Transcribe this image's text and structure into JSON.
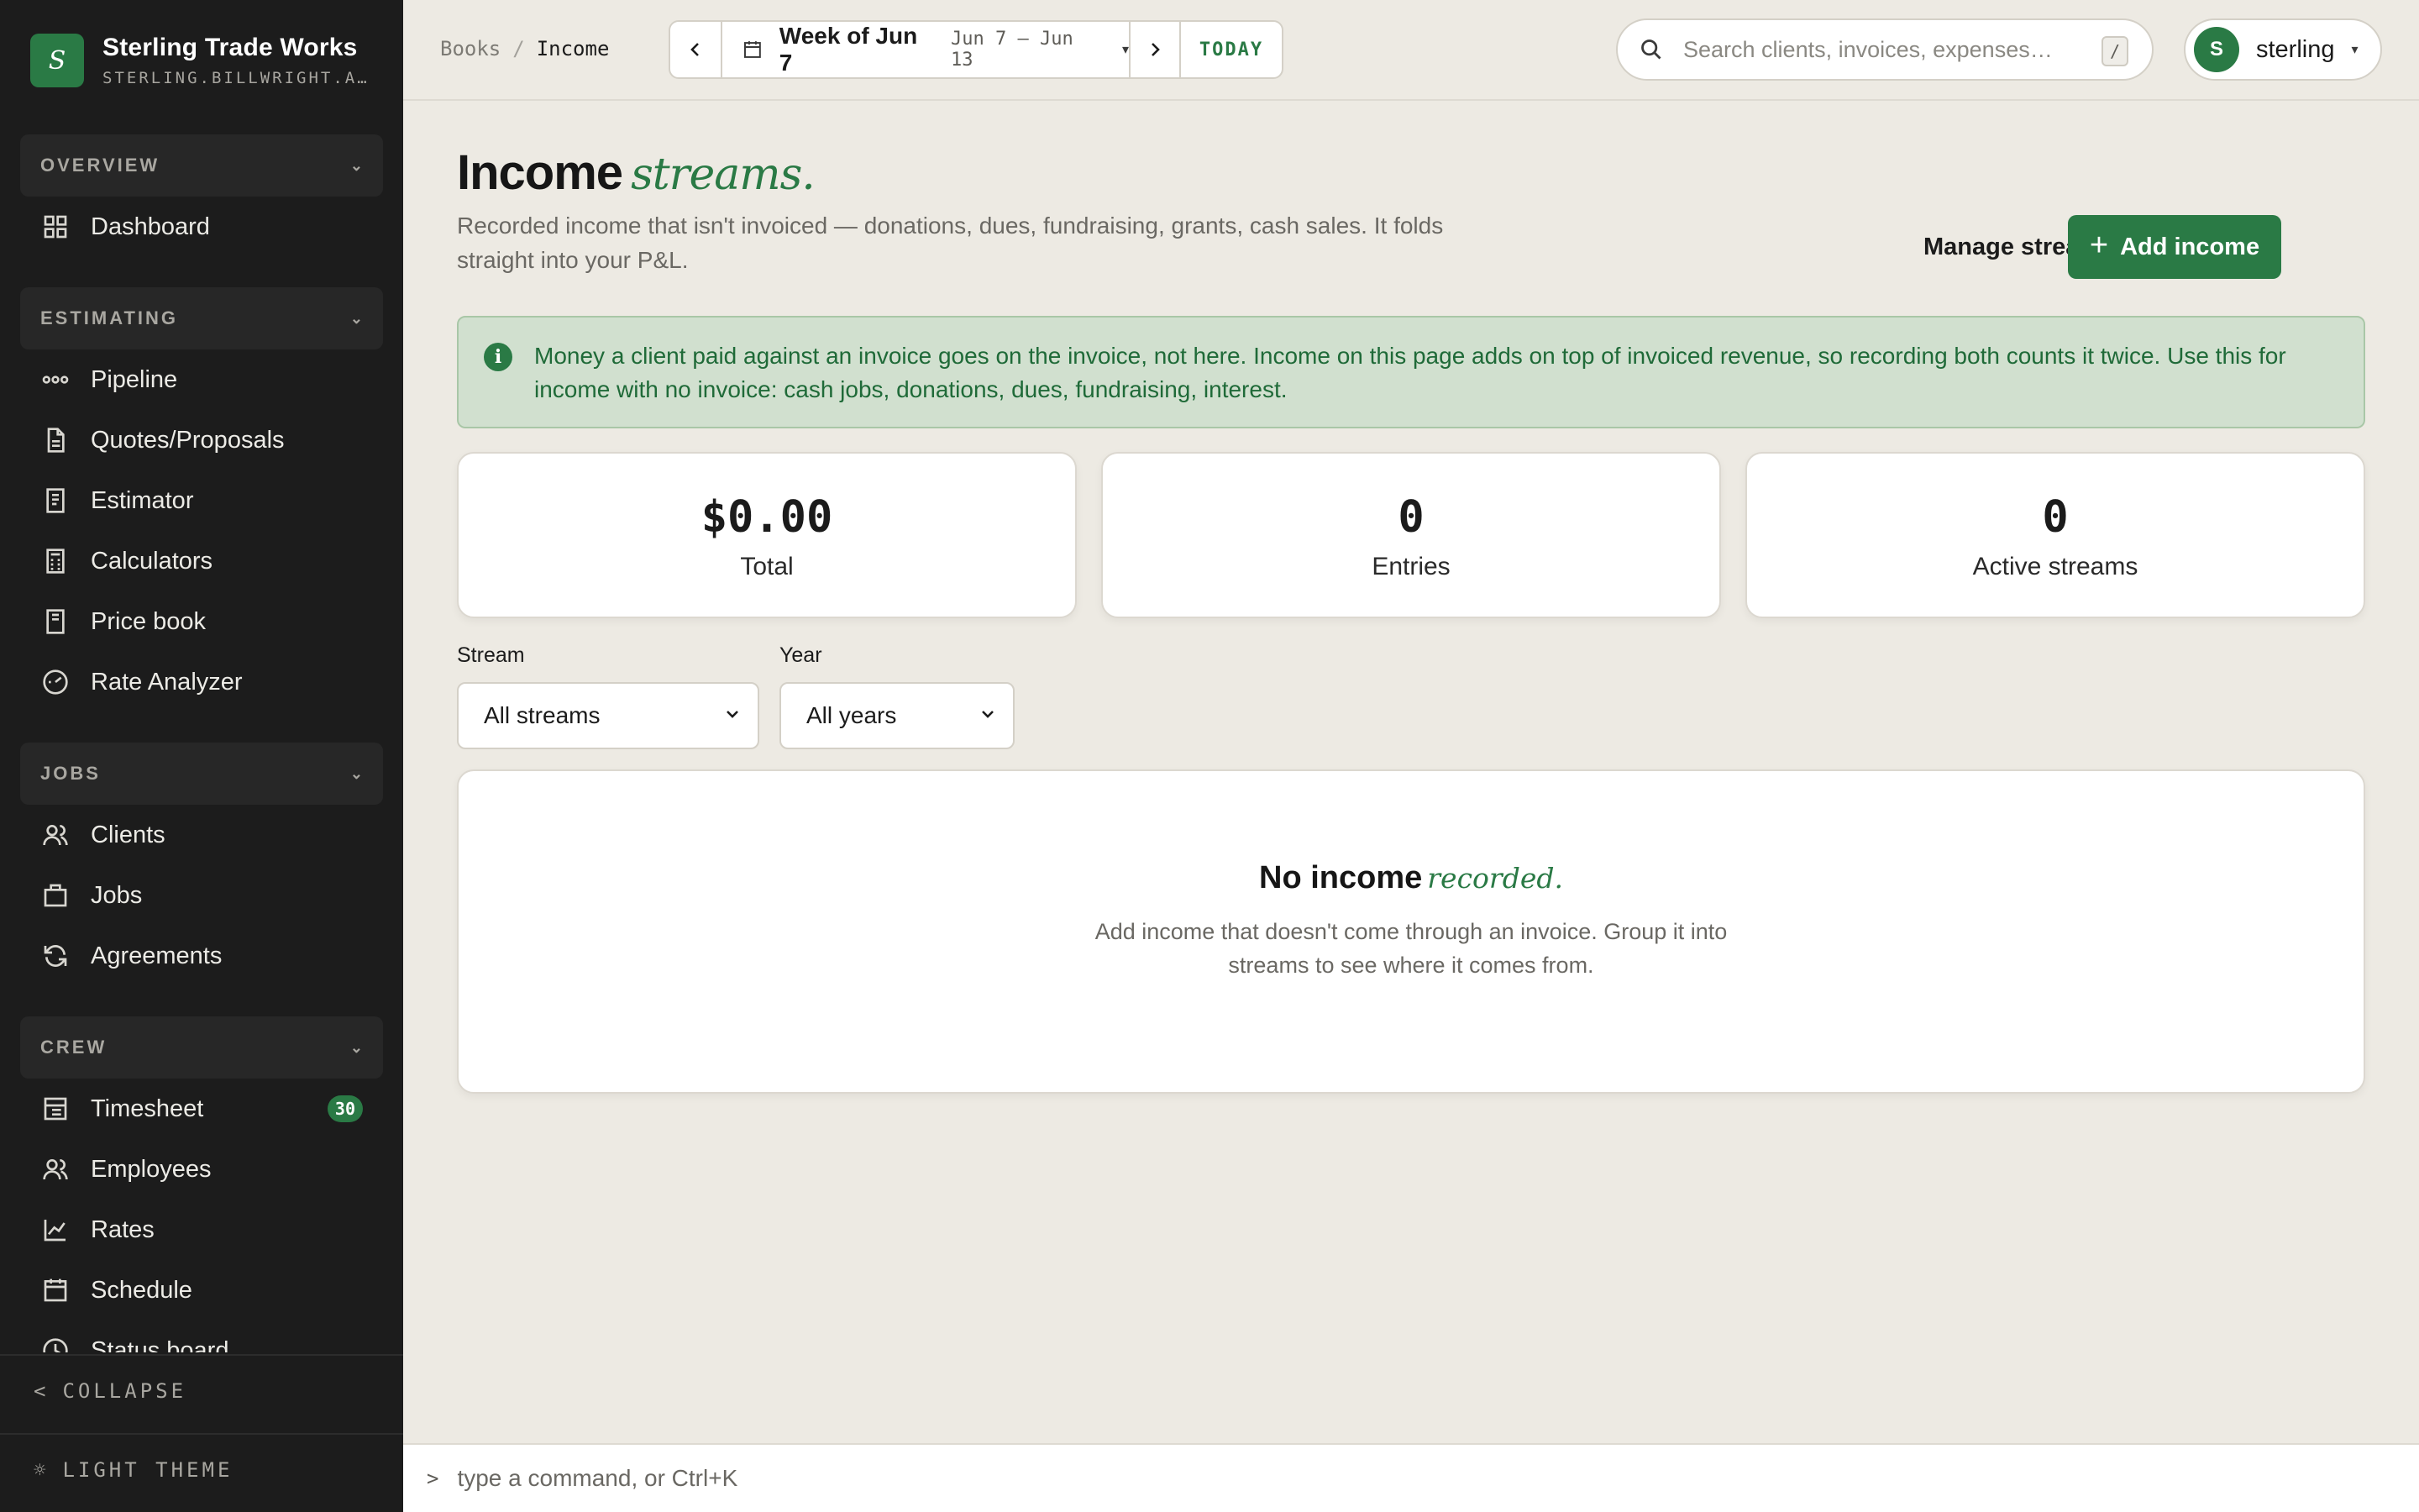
{
  "brand": {
    "logo_letter": "S",
    "name": "Sterling Trade Works",
    "domain": "STERLING.BILLWRIGHT.A…"
  },
  "sidebar": {
    "sections": [
      {
        "title": "OVERVIEW",
        "items": [
          {
            "label": "Dashboard",
            "icon": "grid-icon"
          }
        ]
      },
      {
        "title": "ESTIMATING",
        "items": [
          {
            "label": "Pipeline",
            "icon": "pipeline-icon"
          },
          {
            "label": "Quotes/Proposals",
            "icon": "document-icon"
          },
          {
            "label": "Estimator",
            "icon": "receipt-icon"
          },
          {
            "label": "Calculators",
            "icon": "calculator-icon"
          },
          {
            "label": "Price book",
            "icon": "book-icon"
          },
          {
            "label": "Rate Analyzer",
            "icon": "gauge-icon"
          }
        ]
      },
      {
        "title": "JOBS",
        "items": [
          {
            "label": "Clients",
            "icon": "users-icon"
          },
          {
            "label": "Jobs",
            "icon": "briefcase-icon"
          },
          {
            "label": "Agreements",
            "icon": "refresh-icon"
          }
        ]
      },
      {
        "title": "CREW",
        "items": [
          {
            "label": "Timesheet",
            "icon": "timesheet-icon",
            "badge": "30"
          },
          {
            "label": "Employees",
            "icon": "users-icon"
          },
          {
            "label": "Rates",
            "icon": "chart-icon"
          },
          {
            "label": "Schedule",
            "icon": "calendar-icon"
          },
          {
            "label": "Status board",
            "icon": "clock-icon"
          }
        ]
      }
    ],
    "collapse_label": "COLLAPSE",
    "theme_label": "LIGHT THEME"
  },
  "topbar": {
    "breadcrumb": [
      "Books",
      "Income"
    ],
    "week_label": "Week of Jun 7",
    "week_range": "Jun 7 – Jun 13",
    "today_label": "TODAY",
    "search_placeholder": "Search clients, invoices, expenses…",
    "search_shortcut": "/",
    "user_initial": "S",
    "user_name": "sterling"
  },
  "page": {
    "title": "Income",
    "title_accent": "streams.",
    "subtitle": "Recorded income that isn't invoiced — donations, dues, fundraising, grants, cash sales. It folds straight into your P&L.",
    "manage_label": "Manage streams",
    "add_label": "Add income",
    "alert": "Money a client paid against an invoice goes on the invoice, not here. Income on this page adds on top of invoiced revenue, so recording both counts it twice. Use this for income with no invoice: cash jobs, donations, dues, fundraising, interest."
  },
  "stats": [
    {
      "value": "$0.00",
      "label": "Total"
    },
    {
      "value": "0",
      "label": "Entries"
    },
    {
      "value": "0",
      "label": "Active streams"
    }
  ],
  "filters": {
    "stream_label": "Stream",
    "stream_value": "All streams",
    "year_label": "Year",
    "year_value": "All years"
  },
  "empty": {
    "title": "No income",
    "title_accent": "recorded.",
    "body": "Add income that doesn't come through an invoice. Group it into streams to see where it comes from."
  },
  "command": {
    "prompt": ">",
    "placeholder": "type a command, or Ctrl+K"
  },
  "colors": {
    "accent": "#2a7a45",
    "sidebar_bg": "#1c1c1c",
    "page_bg": "#edeae3",
    "alert_bg": "#d1e0cf"
  }
}
